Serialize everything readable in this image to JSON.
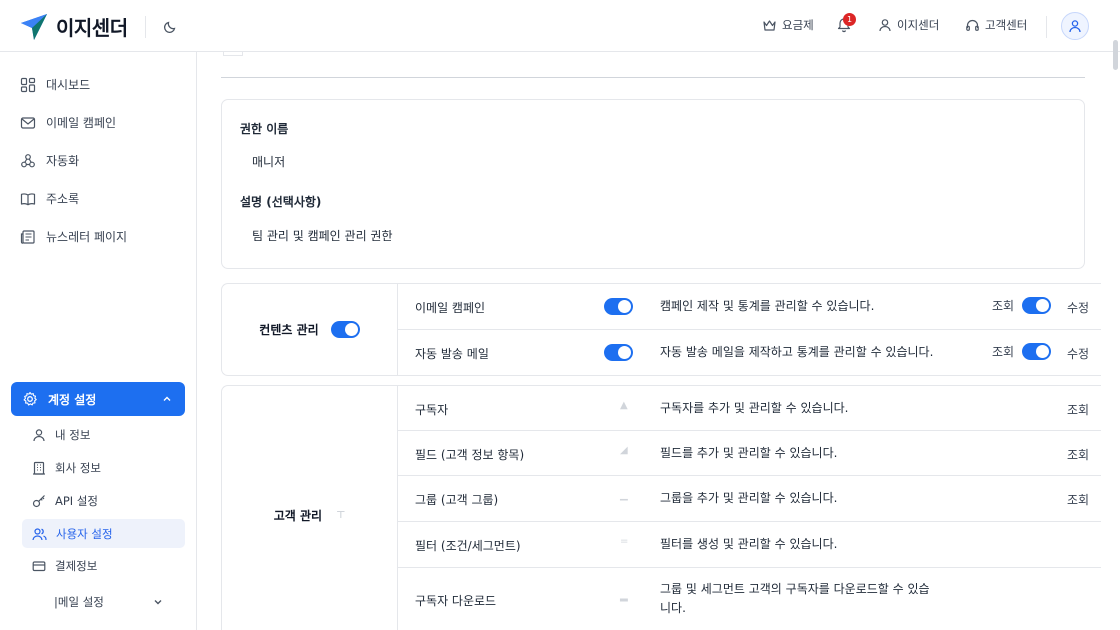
{
  "header": {
    "brand": "이지센더",
    "pricing": "요금제",
    "notification_count": "1",
    "account": "이지센더",
    "support": "고객센터"
  },
  "sidebar": {
    "items": [
      {
        "label": "대시보드",
        "icon": "dashboard-icon"
      },
      {
        "label": "이메일 캠페인",
        "icon": "mail-icon"
      },
      {
        "label": "자동화",
        "icon": "automation-icon"
      },
      {
        "label": "주소록",
        "icon": "book-icon"
      },
      {
        "label": "뉴스레터 페이지",
        "icon": "newsletter-icon"
      }
    ],
    "active_group": "계정 설정",
    "sub_items": [
      {
        "label": "내 정보",
        "icon": "user-icon"
      },
      {
        "label": "회사 정보",
        "icon": "building-icon"
      },
      {
        "label": "API 설정",
        "icon": "key-icon"
      },
      {
        "label": "사용자 설정",
        "icon": "users-icon"
      },
      {
        "label": "결제정보",
        "icon": "card-icon"
      },
      {
        "label": "|메일 설정",
        "icon": ""
      }
    ]
  },
  "role": {
    "name_label": "권한 이름",
    "name_value": "매니저",
    "desc_label": "설명 (선택사항)",
    "desc_value": "팀 관리 및 캠페인 관리 권한"
  },
  "groups": [
    {
      "title": "컨텐츠 관리",
      "enabled": true,
      "rows": [
        {
          "name": "이메일 캠페인",
          "desc": "캠페인 제작 및 통계를 관리할 수 있습니다.",
          "view": "조회",
          "edit": "수정"
        },
        {
          "name": "자동 발송 메일",
          "desc": "자동 발송 메일을 제작하고 통계를 관리할 수 있습니다.",
          "view": "조회",
          "edit": "수정"
        }
      ]
    },
    {
      "title": "고객 관리",
      "rows": [
        {
          "name": "구독자",
          "desc": "구독자를 추가 및 관리할 수 있습니다.",
          "view": "조회"
        },
        {
          "name": "필드 (고객 정보 항목)",
          "desc": "필드를 추가 및 관리할 수 있습니다.",
          "view": "조회"
        },
        {
          "name": "그룹 (고객 그룹)",
          "desc": "그룹을 추가 및 관리할 수 있습니다.",
          "view": "조회"
        },
        {
          "name": "필터 (조건/세그먼트)",
          "desc": "필터를 생성 및 관리할 수 있습니다."
        },
        {
          "name": "구독자 다운로드",
          "desc_line1": "그룹 및 세그먼트 고객의 구독자를 다운로드할 수 있습",
          "desc_line2": "니다."
        }
      ]
    }
  ],
  "colors": {
    "accent": "#1d6ff0",
    "badge": "#dc2626"
  }
}
